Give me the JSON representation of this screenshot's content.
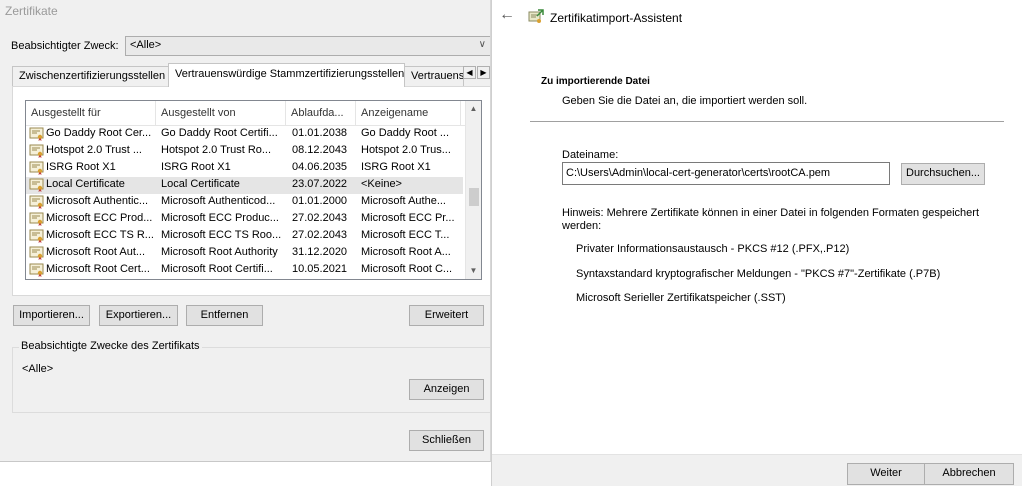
{
  "cert_dialog": {
    "title": "Zertifikate",
    "purpose_label": "Beabsichtigter Zweck:",
    "purpose_value": "<Alle>",
    "tabs": [
      "Zwischenzertifizierungsstellen",
      "Vertrauenswürdige Stammzertifizierungsstellen",
      "Vertrauens"
    ],
    "columns": [
      "Ausgestellt für",
      "Ausgestellt von",
      "Ablaufda...",
      "Anzeigename"
    ],
    "rows": [
      {
        "issued_to": "Go Daddy Root Cer...",
        "issued_by": "Go Daddy Root Certifi...",
        "expires": "01.01.2038",
        "name": "Go Daddy Root ..."
      },
      {
        "issued_to": "Hotspot 2.0 Trust ...",
        "issued_by": "Hotspot 2.0 Trust Ro...",
        "expires": "08.12.2043",
        "name": "Hotspot 2.0 Trus..."
      },
      {
        "issued_to": "ISRG Root X1",
        "issued_by": "ISRG Root X1",
        "expires": "04.06.2035",
        "name": "ISRG Root X1"
      },
      {
        "issued_to": "Local Certificate",
        "issued_by": "Local Certificate",
        "expires": "23.07.2022",
        "name": "<Keine>"
      },
      {
        "issued_to": "Microsoft Authentic...",
        "issued_by": "Microsoft Authenticod...",
        "expires": "01.01.2000",
        "name": "Microsoft Authe..."
      },
      {
        "issued_to": "Microsoft ECC Prod...",
        "issued_by": "Microsoft ECC Produc...",
        "expires": "27.02.2043",
        "name": "Microsoft ECC Pr..."
      },
      {
        "issued_to": "Microsoft ECC TS R...",
        "issued_by": "Microsoft ECC TS Roo...",
        "expires": "27.02.2043",
        "name": "Microsoft ECC T..."
      },
      {
        "issued_to": "Microsoft Root Aut...",
        "issued_by": "Microsoft Root Authority",
        "expires": "31.12.2020",
        "name": "Microsoft Root A..."
      },
      {
        "issued_to": "Microsoft Root Cert...",
        "issued_by": "Microsoft Root Certifi...",
        "expires": "10.05.2021",
        "name": "Microsoft Root C..."
      }
    ],
    "buttons": {
      "import": "Importieren...",
      "export": "Exportieren...",
      "remove": "Entfernen",
      "advanced": "Erweitert",
      "view": "Anzeigen",
      "close": "Schließen"
    },
    "purposes_group_label": "Beabsichtigte Zwecke des Zertifikats",
    "purposes_value": "<Alle>"
  },
  "wizard": {
    "title": "Zertifikatimport-Assistent",
    "heading": "Zu importierende Datei",
    "subheading": "Geben Sie die Datei an, die importiert werden soll.",
    "filename_label": "Dateiname:",
    "filename_value": "C:\\Users\\Admin\\local-cert-generator\\certs\\rootCA.pem",
    "browse_button": "Durchsuchen...",
    "hint": "Hinweis: Mehrere Zertifikate können in einer Datei in folgenden Formaten gespeichert werden:",
    "formats": [
      "Privater Informationsaustausch - PKCS #12 (.PFX,.P12)",
      "Syntaxstandard kryptografischer Meldungen - \"PKCS #7\"-Zertifikate (.P7B)",
      "Microsoft Serieller Zertifikatspeicher (.SST)"
    ],
    "next_button": "Weiter",
    "cancel_button": "Abbrechen"
  },
  "icons": {
    "back": "back-arrow-icon",
    "wizard": "certificate-wizard-icon",
    "cert": "certificate-icon"
  }
}
